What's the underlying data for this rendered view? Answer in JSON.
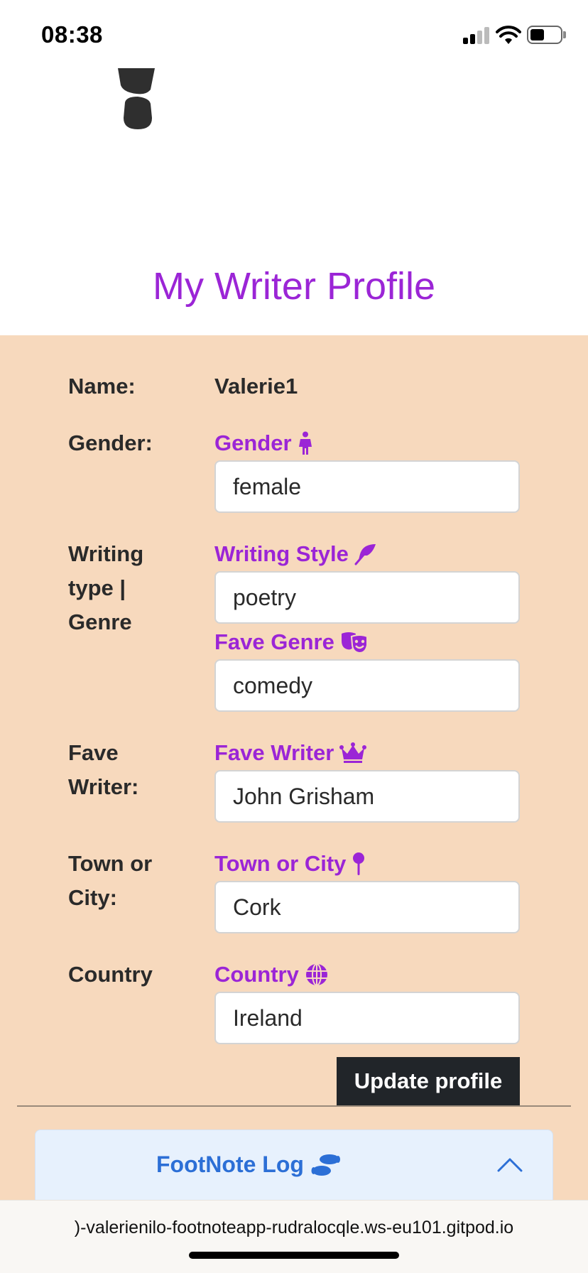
{
  "status_bar": {
    "time": "08:38"
  },
  "page": {
    "title": "My Writer Profile"
  },
  "profile": {
    "name_label": "Name:",
    "name_value": "Valerie1",
    "gender_label": "Gender:",
    "writing_label_line1": "Writing",
    "writing_label_line2": "type |",
    "writing_label_line3": "Genre",
    "fave_writer_label_line1": "Fave",
    "fave_writer_label_line2": "Writer:",
    "town_label_line1": "Town or",
    "town_label_line2": "City:",
    "country_label": "Country",
    "fields": {
      "gender": {
        "label": "Gender",
        "value": "female",
        "icon": "person-standing-dress-icon"
      },
      "writing_style": {
        "label": "Writing Style",
        "value": "poetry",
        "icon": "feather-icon"
      },
      "fave_genre": {
        "label": "Fave Genre",
        "value": "comedy",
        "icon": "theater-masks-icon"
      },
      "fave_writer": {
        "label": "Fave Writer",
        "value": "John Grisham",
        "icon": "crown-icon"
      },
      "town_or_city": {
        "label": "Town or City",
        "value": "Cork",
        "icon": "map-pin-icon"
      },
      "country": {
        "label": "Country",
        "value": "Ireland",
        "icon": "globe-icon"
      }
    },
    "update_button": "Update profile"
  },
  "footnote_log": {
    "title": "FootNote Log",
    "icon": "shoe-prints-icon",
    "expanded": true
  },
  "browser": {
    "url": ")-valerienilo-footnoteapp-rudralocqle.ws-eu101.gitpod.io"
  },
  "colors": {
    "accent_purple": "#9b25d6",
    "panel_background": "#f7d9bd",
    "accordion_text": "#2c6fd6",
    "button_background": "#212529"
  }
}
